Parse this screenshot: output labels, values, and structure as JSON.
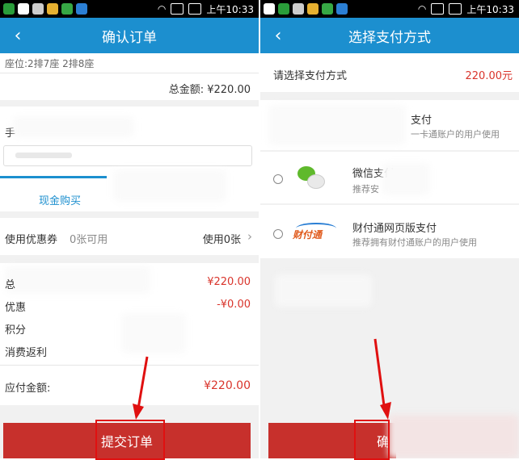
{
  "statusbar": {
    "time": "上午10:33"
  },
  "left": {
    "title": "确认订单",
    "seat_info": "座位:2排7座 2排8座",
    "total_label": "总金额: ¥220.00",
    "cash_tab": "现金购买",
    "coupon_label": "使用优惠券",
    "coupon_available": "0张可用",
    "coupon_use": "使用0张",
    "amount_value": "¥220.00",
    "discount_label": "优惠",
    "discount_value": "-¥0.00",
    "points_label": "积分",
    "rebate_label": "消费返利",
    "payable_label": "应付金额:",
    "payable_value": "¥220.00",
    "submit_button": "提交订单"
  },
  "right": {
    "title": "选择支付方式",
    "choose_label": "请选择支付方式",
    "amount": "220.00元",
    "method1_title": "支付",
    "method1_desc": "一卡通账户的用户使用",
    "method2_title": "微信支付",
    "method2_desc": "推荐安",
    "method3_title": "财付通网页版支付",
    "method3_desc": "推荐拥有财付通账户的用户使用",
    "tenpay_logo": "财付通",
    "confirm_button": "确"
  },
  "colors": {
    "accent": "#1c8fcf",
    "button_red": "#c7302c",
    "price_red": "#d9342b",
    "annotation": "#e01010"
  }
}
